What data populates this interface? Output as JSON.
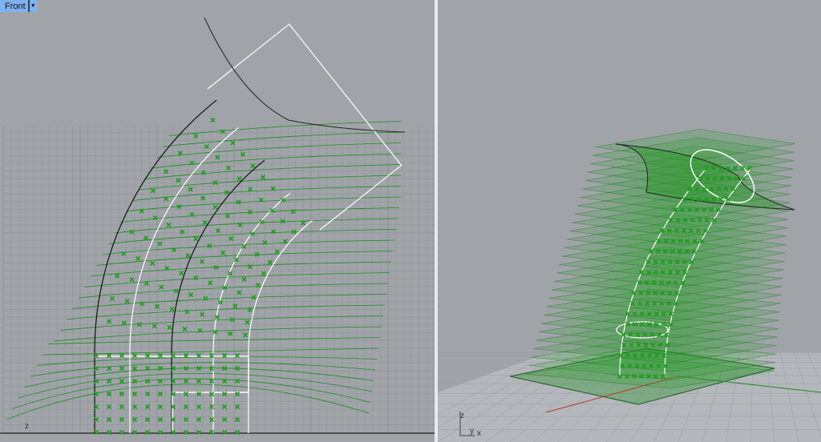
{
  "left_viewport": {
    "name": "Front",
    "menu_icon": "dropdown-arrow",
    "axis_label": "z"
  },
  "right_viewport": {
    "axis_labels": {
      "z": "z",
      "y": "y",
      "x": "x"
    }
  },
  "colors": {
    "background": "#a0a4a9",
    "grid": "#8e9296",
    "curve": "#1a8c1a",
    "marker": "#1f9a1f",
    "edge": "#ffffff",
    "tab": "#7fb0f2"
  }
}
